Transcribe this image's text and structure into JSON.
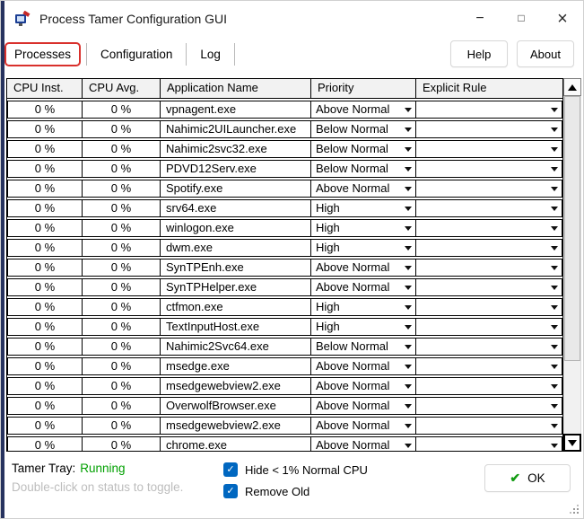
{
  "window": {
    "title": "Process Tamer Configuration GUI"
  },
  "icons": {
    "minimize": "−",
    "maximize": "□",
    "close": "×",
    "checkbox_check": "✓",
    "ok_check": "✔"
  },
  "tabs": [
    {
      "label": "Processes",
      "active": true,
      "highlighted_red": true
    },
    {
      "label": "Configuration",
      "active": false
    },
    {
      "label": "Log",
      "active": false
    }
  ],
  "buttons": {
    "help": "Help",
    "about": "About",
    "ok": "OK"
  },
  "table": {
    "columns": [
      "CPU Inst.",
      "CPU Avg.",
      "Application Name",
      "Priority",
      "Explicit Rule"
    ],
    "rows": [
      {
        "cpu_inst": "0 %",
        "cpu_avg": "0 %",
        "app": "vpnagent.exe",
        "priority": "Above Normal",
        "rule": ""
      },
      {
        "cpu_inst": "0 %",
        "cpu_avg": "0 %",
        "app": "Nahimic2UILauncher.exe",
        "priority": "Below Normal",
        "rule": ""
      },
      {
        "cpu_inst": "0 %",
        "cpu_avg": "0 %",
        "app": "Nahimic2svc32.exe",
        "priority": "Below Normal",
        "rule": ""
      },
      {
        "cpu_inst": "0 %",
        "cpu_avg": "0 %",
        "app": "PDVD12Serv.exe",
        "priority": "Below Normal",
        "rule": ""
      },
      {
        "cpu_inst": "0 %",
        "cpu_avg": "0 %",
        "app": "Spotify.exe",
        "priority": "Above Normal",
        "rule": ""
      },
      {
        "cpu_inst": "0 %",
        "cpu_avg": "0 %",
        "app": "srv64.exe",
        "priority": "High",
        "rule": ""
      },
      {
        "cpu_inst": "0 %",
        "cpu_avg": "0 %",
        "app": "winlogon.exe",
        "priority": "High",
        "rule": ""
      },
      {
        "cpu_inst": "0 %",
        "cpu_avg": "0 %",
        "app": "dwm.exe",
        "priority": "High",
        "rule": ""
      },
      {
        "cpu_inst": "0 %",
        "cpu_avg": "0 %",
        "app": "SynTPEnh.exe",
        "priority": "Above Normal",
        "rule": ""
      },
      {
        "cpu_inst": "0 %",
        "cpu_avg": "0 %",
        "app": "SynTPHelper.exe",
        "priority": "Above Normal",
        "rule": ""
      },
      {
        "cpu_inst": "0 %",
        "cpu_avg": "0 %",
        "app": "ctfmon.exe",
        "priority": "High",
        "rule": ""
      },
      {
        "cpu_inst": "0 %",
        "cpu_avg": "0 %",
        "app": "TextInputHost.exe",
        "priority": "High",
        "rule": ""
      },
      {
        "cpu_inst": "0 %",
        "cpu_avg": "0 %",
        "app": "Nahimic2Svc64.exe",
        "priority": "Below Normal",
        "rule": ""
      },
      {
        "cpu_inst": "0 %",
        "cpu_avg": "0 %",
        "app": "msedge.exe",
        "priority": "Above Normal",
        "rule": ""
      },
      {
        "cpu_inst": "0 %",
        "cpu_avg": "0 %",
        "app": "msedgewebview2.exe",
        "priority": "Above Normal",
        "rule": ""
      },
      {
        "cpu_inst": "0 %",
        "cpu_avg": "0 %",
        "app": "OverwolfBrowser.exe",
        "priority": "Above Normal",
        "rule": ""
      },
      {
        "cpu_inst": "0 %",
        "cpu_avg": "0 %",
        "app": "msedgewebview2.exe",
        "priority": "Above Normal",
        "rule": ""
      },
      {
        "cpu_inst": "0 %",
        "cpu_avg": "0 %",
        "app": "chrome.exe",
        "priority": "Above Normal",
        "rule": ""
      }
    ]
  },
  "footer": {
    "tray_label": "Tamer Tray:",
    "tray_status": "Running",
    "tray_hint": "Double-click on status to toggle.",
    "checkboxes": [
      {
        "label": "Hide < 1% Normal CPU",
        "checked": true
      },
      {
        "label": "Remove Old",
        "checked": true
      }
    ]
  },
  "colors": {
    "highlight_red": "#d9302c",
    "status_green": "#00a000",
    "checkbox_blue": "#0067c0"
  }
}
